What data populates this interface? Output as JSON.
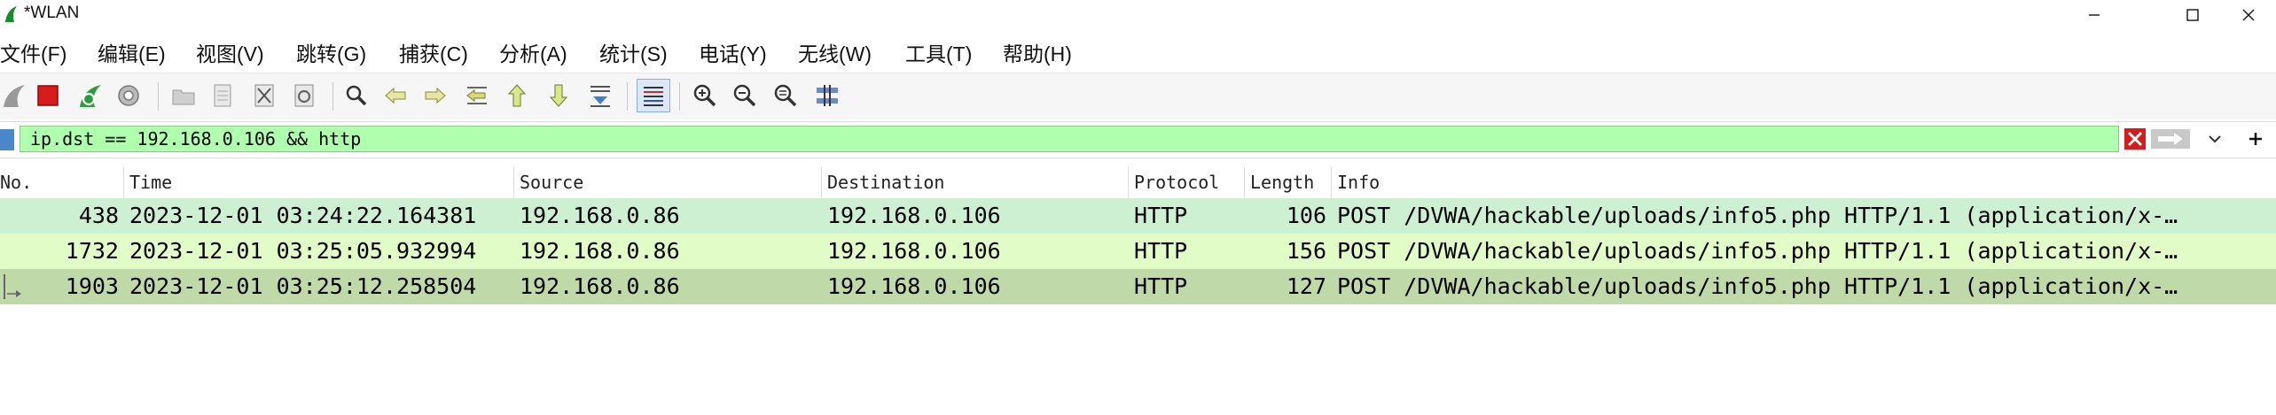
{
  "window": {
    "title": "*WLAN"
  },
  "menu": [
    {
      "label": "文件(F)"
    },
    {
      "label": "编辑(E)"
    },
    {
      "label": "视图(V)"
    },
    {
      "label": "跳转(G)"
    },
    {
      "label": "捕获(C)"
    },
    {
      "label": "分析(A)"
    },
    {
      "label": "统计(S)"
    },
    {
      "label": "电话(Y)"
    },
    {
      "label": "无线(W)"
    },
    {
      "label": "工具(T)"
    },
    {
      "label": "帮助(H)"
    }
  ],
  "toolbar": {
    "icons": [
      "shark-fin-start-icon",
      "stop-capture-icon",
      "restart-capture-icon",
      "capture-options-icon",
      "open-file-icon",
      "save-file-icon",
      "close-file-icon",
      "reload-file-icon",
      "find-packet-icon",
      "go-back-icon",
      "go-forward-icon",
      "go-to-packet-icon",
      "go-first-icon",
      "go-last-icon",
      "autoscroll-icon",
      "colorize-icon",
      "zoom-in-icon",
      "zoom-out-icon",
      "zoom-normal-icon",
      "resize-columns-icon"
    ]
  },
  "filter": {
    "value": "ip.dst == 192.168.0.106 && http",
    "valid_color": "#afffaf"
  },
  "columns": [
    "No.",
    "Time",
    "Source",
    "Destination",
    "Protocol",
    "Length",
    "Info"
  ],
  "packets": [
    {
      "no": "438",
      "time": "2023-12-01 03:24:22.164381",
      "source": "192.168.0.86",
      "destination": "192.168.0.106",
      "protocol": "HTTP",
      "length": "106",
      "info": "POST /DVWA/hackable/uploads/info5.php HTTP/1.1  (application/x-…",
      "bg": "#cdf0d3"
    },
    {
      "no": "1732",
      "time": "2023-12-01 03:25:05.932994",
      "source": "192.168.0.86",
      "destination": "192.168.0.106",
      "protocol": "HTTP",
      "length": "156",
      "info": "POST /DVWA/hackable/uploads/info5.php HTTP/1.1  (application/x-…",
      "bg": "#e2fcc7"
    },
    {
      "no": "1903",
      "time": "2023-12-01 03:25:12.258504",
      "source": "192.168.0.86",
      "destination": "192.168.0.106",
      "protocol": "HTTP",
      "length": "127",
      "info": "POST /DVWA/hackable/uploads/info5.php HTTP/1.1  (application/x-…",
      "bg": "#bfd9a8"
    }
  ]
}
